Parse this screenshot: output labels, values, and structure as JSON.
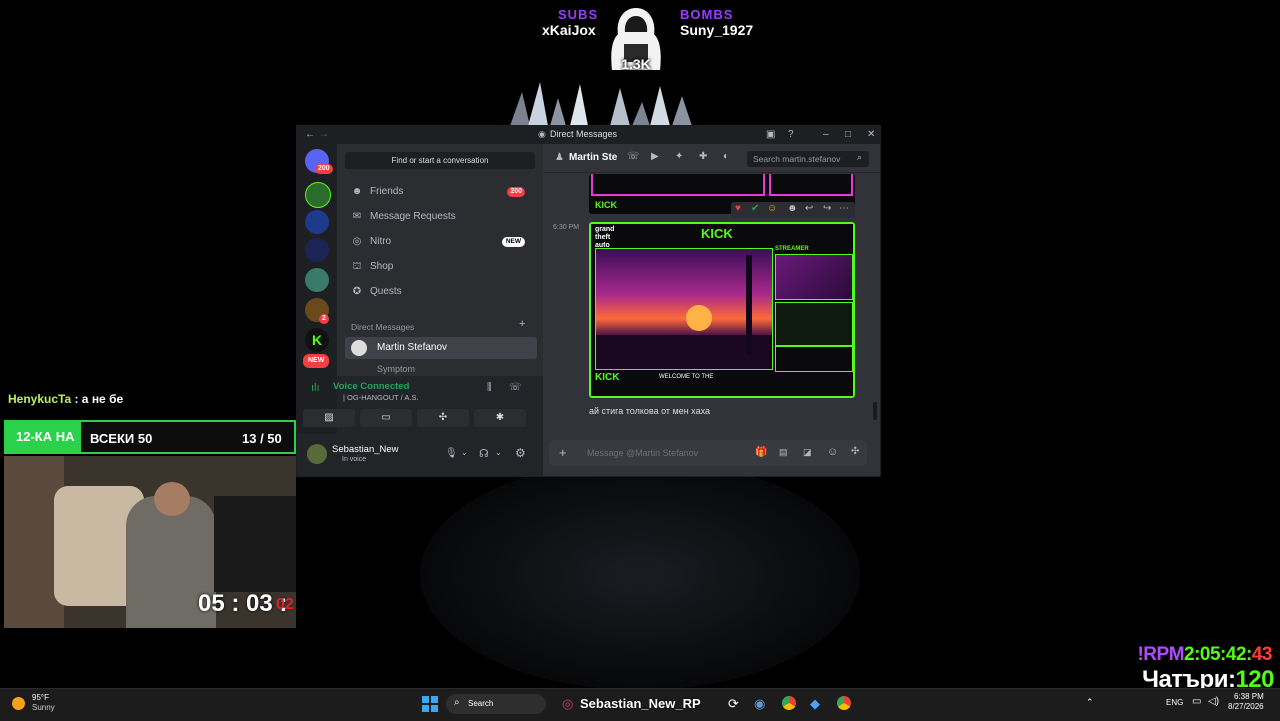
{
  "overlay": {
    "subs_label": "SUBS",
    "subs_name": "xKaiJox",
    "bombs_label": "BOMBS",
    "bombs_name": "Suny_1927",
    "count": "1.3K",
    "chat_user": "HenykucTa",
    "chat_text": " : а не бе",
    "goal_text_a": "12-КА НА",
    "goal_text_b": "ВСЕКИ 50",
    "goal_progress": "13 / 50",
    "goal_fraction": 0.26,
    "timer_main": "05 : 03 :",
    "timer_sec": "02",
    "rpm_label": "!RPM",
    "rpm_time": "2:05:42:",
    "rpm_sec": "43",
    "chatri_label": "Чатъри:",
    "chatri_value": "120"
  },
  "discord": {
    "window_title": "Direct Messages",
    "find_placeholder": "Find or start a conversation",
    "nav": [
      {
        "label": "Friends",
        "icon": "friends-icon",
        "badge": "200"
      },
      {
        "label": "Message Requests",
        "icon": "mail-icon"
      },
      {
        "label": "Nitro",
        "icon": "nitro-icon",
        "badge": "NEW"
      },
      {
        "label": "Shop",
        "icon": "shop-icon"
      },
      {
        "label": "Quests",
        "icon": "quests-icon"
      }
    ],
    "server_badge": "200",
    "server_badge2": "2",
    "server_new": "NEW",
    "dm_header": "Direct Messages",
    "dm_active": "Martin Stefanov",
    "dm_next": "Symptom",
    "voice_status": "Voice Connected",
    "voice_channel": "| OG-HANGOUT / A.S.",
    "user_name": "Sebastian_New",
    "user_status": "In voice",
    "chat_title": "Martin Ste",
    "search_placeholder": "Search martin.stefanov",
    "timestamp": "6:30 PM",
    "message_text": "ай стига толкова от мен хаха",
    "composer_placeholder": "Message @Martin Stefanov",
    "image_brand": "KICK",
    "image_sub": "STREAMER",
    "image_welcome": "WELCOME TO THE"
  },
  "taskbar": {
    "weather_temp": "95°F",
    "weather_cond": "Sunny",
    "search_label": "Search",
    "taskbar_app_label": "Sebastian_New_RP",
    "lang": "ENG",
    "time": "6:38 PM",
    "date": "8/27/2026"
  },
  "colors": {
    "accent": "#5865f2",
    "kick_green": "#53fc18",
    "purple": "#9a3cff",
    "red": "#f23f43"
  }
}
